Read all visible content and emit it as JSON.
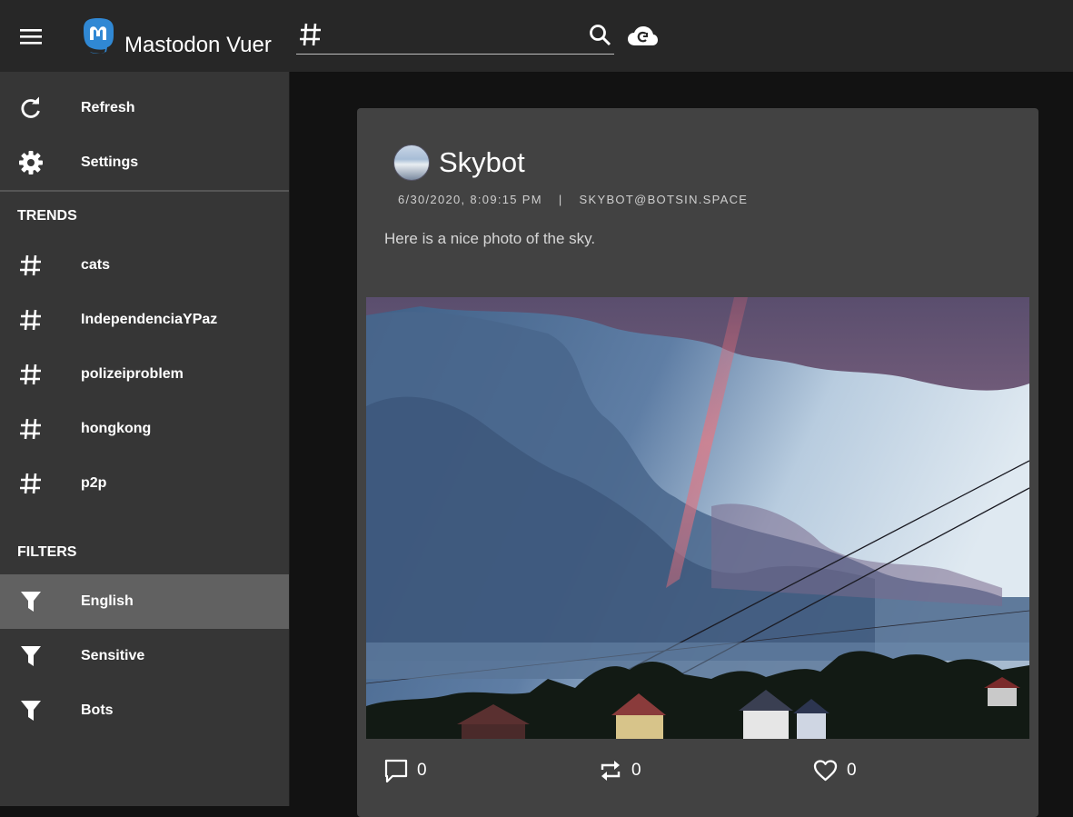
{
  "app": {
    "title": "Mastodon Vuer",
    "brand_color": "#3088d4"
  },
  "search": {
    "prefix_icon": "hashtag-icon",
    "value": "",
    "placeholder": ""
  },
  "sidebar": {
    "actions": [
      {
        "label": "Refresh",
        "icon": "refresh-icon"
      },
      {
        "label": "Settings",
        "icon": "gear-icon"
      }
    ],
    "trends_heading": "TRENDS",
    "trends": [
      {
        "label": "cats",
        "icon": "hashtag-icon"
      },
      {
        "label": "IndependenciaYPaz",
        "icon": "hashtag-icon"
      },
      {
        "label": "polizeiproblem",
        "icon": "hashtag-icon"
      },
      {
        "label": "hongkong",
        "icon": "hashtag-icon"
      },
      {
        "label": "p2p",
        "icon": "hashtag-icon"
      }
    ],
    "filters_heading": "FILTERS",
    "filters": [
      {
        "label": "English",
        "icon": "filter-icon",
        "active": true
      },
      {
        "label": "Sensitive",
        "icon": "filter-icon",
        "active": false
      },
      {
        "label": "Bots",
        "icon": "filter-icon",
        "active": false
      }
    ]
  },
  "post": {
    "author": "Skybot",
    "timestamp": "6/30/2020, 8:09:15 PM",
    "separator": "|",
    "handle": "SKYBOT@BOTSIN.SPACE",
    "text": "Here is a nice photo of the sky.",
    "replies": "0",
    "boosts": "0",
    "favourites": "0"
  }
}
